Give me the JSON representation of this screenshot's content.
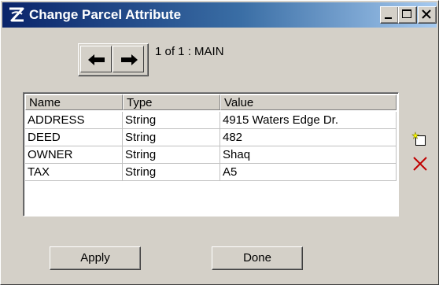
{
  "window": {
    "title": "Change Parcel Attribute"
  },
  "navigation": {
    "record_label": "1 of 1 : MAIN"
  },
  "table": {
    "columns": [
      "Name",
      "Type",
      "Value"
    ],
    "rows": [
      {
        "name": "ADDRESS",
        "type": "String",
        "value": "4915 Waters Edge Dr."
      },
      {
        "name": "DEED",
        "type": "String",
        "value": "482"
      },
      {
        "name": "OWNER",
        "type": "String",
        "value": "Shaq"
      },
      {
        "name": "TAX",
        "type": "String",
        "value": "A5"
      }
    ]
  },
  "buttons": {
    "apply_label": "Apply",
    "done_label": "Done"
  },
  "icons": {
    "app": "app-logo-icon",
    "back": "arrow-left-icon",
    "forward": "arrow-right-icon",
    "add": "add-attribute-icon",
    "delete": "delete-x-icon"
  },
  "colors": {
    "titlebar_start": "#0a246a",
    "titlebar_end": "#a6caf0",
    "delete_red": "#c00000"
  }
}
